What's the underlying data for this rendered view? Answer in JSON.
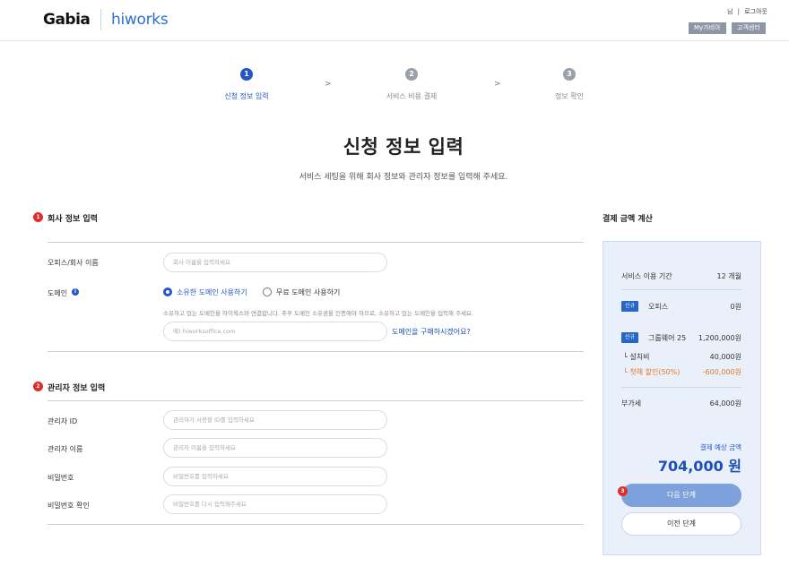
{
  "header": {
    "brand": "Gabia",
    "product": "hiworks",
    "user_suffix": "님",
    "logout": "로그아웃",
    "my_gabia": "My가비아",
    "support": "고객센터"
  },
  "steps": [
    {
      "num": "1",
      "label": "신청 정보 입력",
      "active": true
    },
    {
      "num": "2",
      "label": "서비스 비용 결제",
      "active": false
    },
    {
      "num": "3",
      "label": "정보 확인",
      "active": false
    }
  ],
  "step_arrow": ">",
  "page": {
    "title": "신청 정보 입력",
    "subtitle": "서비스 세팅을 위해 회사 정보와 관리자 정보를 입력해 주세요."
  },
  "company": {
    "badge": "1",
    "title": "회사 정보 입력",
    "name_label": "오피스/회사 이름",
    "name_placeholder": "회사 이름을 입력하세요",
    "domain_label": "도메인",
    "domain_info": "i",
    "radio_own": "소유한 도메인 사용하기",
    "radio_free": "무료 도메인 사용하기",
    "domain_help": "소유하고 있는 도메인을 하이웍스와 연결합니다. 추후 도메인 소유권을 인증해야 하므로, 소유하고 있는 도메인을 입력해 주세요.",
    "domain_placeholder": "예) hiworksoffice.com",
    "domain_buy_link": "도메인을 구매하시겠어요?"
  },
  "admin": {
    "badge": "2",
    "title": "관리자 정보 입력",
    "id_label": "관리자 ID",
    "id_placeholder": "관리자가 사용할 ID를 입력하세요",
    "name_label": "관리자 이름",
    "name_placeholder": "관리자 이름을 입력하세요",
    "pw_label": "비밀번호",
    "pw_placeholder": "비밀번호를 입력하세요",
    "pw2_label": "비밀번호 확인",
    "pw2_placeholder": "비밀번호를 다시 입력해주세요"
  },
  "summary": {
    "title": "결제 금액 계산",
    "period_label": "서비스 이용 기간",
    "period_value": "12 개월",
    "new_tag": "신규",
    "office_label": "오피스",
    "office_value": "0원",
    "groupware_label": "그룹웨어 25",
    "groupware_value": "1,200,000원",
    "setup_label": "└ 설치비",
    "setup_value": "40,000원",
    "discount_label": "└ 첫해 할인(50%)",
    "discount_value": "-600,000원",
    "vat_label": "부가세",
    "vat_value": "64,000원",
    "total_label": "결제 예상 금액",
    "total_value": "704,000 원",
    "next_badge": "3",
    "next_button": "다음 단계",
    "prev_button": "이전 단계"
  },
  "colors": {
    "accent": "#2456c9",
    "badge_red": "#e22c2c",
    "panel_bg": "#e9f0f9",
    "discount": "#e07a2f"
  }
}
